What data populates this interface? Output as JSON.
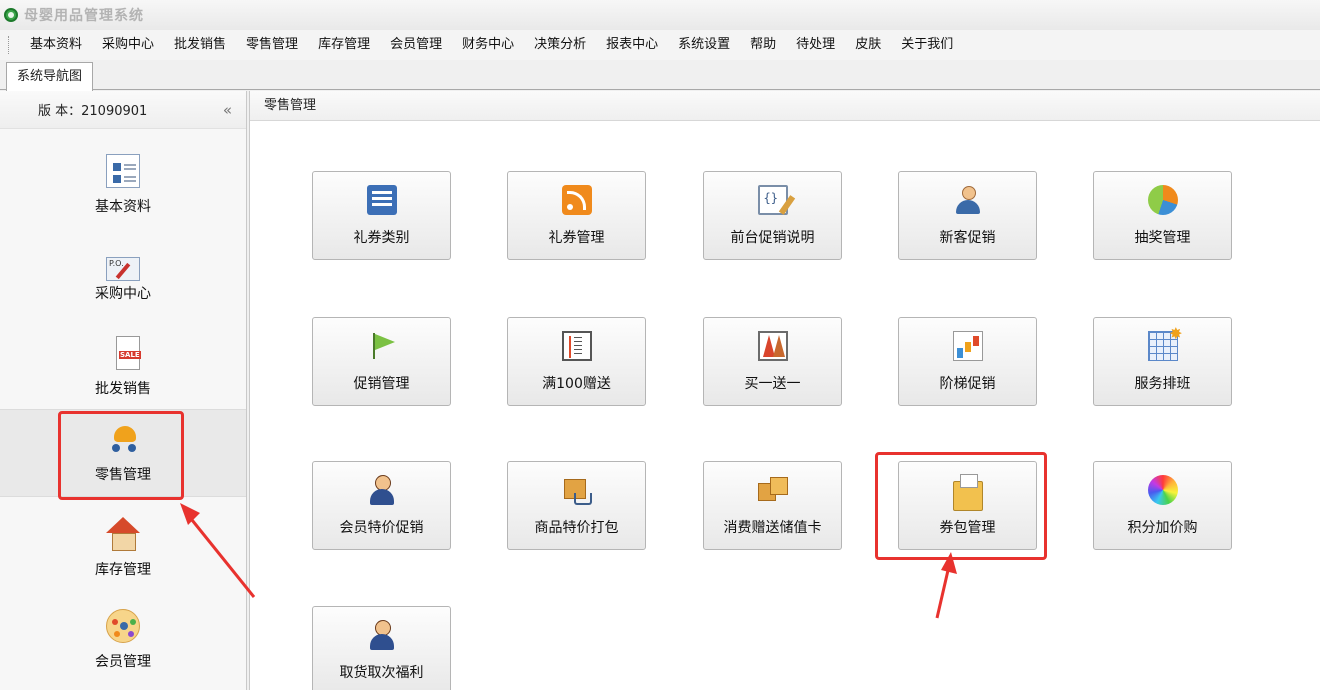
{
  "window": {
    "title": "母婴用品管理系统"
  },
  "menubar": {
    "items": [
      "基本资料",
      "采购中心",
      "批发销售",
      "零售管理",
      "库存管理",
      "会员管理",
      "财务中心",
      "决策分析",
      "报表中心",
      "系统设置",
      "帮助",
      "待处理",
      "皮肤",
      "关于我们"
    ]
  },
  "tabs": [
    {
      "label": "系统导航图"
    }
  ],
  "sidebar": {
    "version": "版 本：21090901",
    "collapse_glyph": "«",
    "items": [
      {
        "label": "基本资料",
        "icon": "profile-card-icon"
      },
      {
        "label": "采购中心",
        "icon": "purchase-order-icon"
      },
      {
        "label": "批发销售",
        "icon": "sale-tag-icon"
      },
      {
        "label": "零售管理",
        "icon": "stroller-icon"
      },
      {
        "label": "库存管理",
        "icon": "house-icon"
      },
      {
        "label": "会员管理",
        "icon": "members-icon"
      }
    ]
  },
  "main": {
    "section_title": "零售管理",
    "tiles": [
      {
        "label": "礼券类别",
        "icon": "list-icon"
      },
      {
        "label": "礼券管理",
        "icon": "rss-icon"
      },
      {
        "label": "前台促销说明",
        "icon": "code-doc-icon"
      },
      {
        "label": "新客促销",
        "icon": "user-icon"
      },
      {
        "label": "抽奖管理",
        "icon": "pie-icon"
      },
      {
        "label": "促销管理",
        "icon": "flag-icon"
      },
      {
        "label": "满100赠送",
        "icon": "ruler-icon"
      },
      {
        "label": "买一送一",
        "icon": "peaks-icon"
      },
      {
        "label": "阶梯促销",
        "icon": "bar-chart-icon"
      },
      {
        "label": "服务排班",
        "icon": "grid-star-icon"
      },
      {
        "label": "会员特价促销",
        "icon": "masked-user-icon"
      },
      {
        "label": "商品特价打包",
        "icon": "box-cart-icon"
      },
      {
        "label": "消费赠送储值卡",
        "icon": "boxes-icon"
      },
      {
        "label": "券包管理",
        "icon": "folder-icon"
      },
      {
        "label": "积分加价购",
        "icon": "color-wheel-icon"
      },
      {
        "label": "取货取次福利",
        "icon": "masked-user-icon"
      }
    ]
  },
  "colors": {
    "annotation": "#e8322e"
  }
}
